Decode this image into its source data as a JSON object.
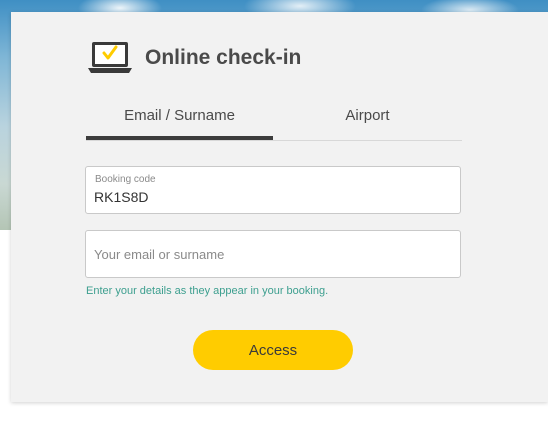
{
  "header": {
    "title": "Online check-in",
    "icon": "laptop-check-icon",
    "accent_color": "#ffcc00"
  },
  "tabs": [
    {
      "label": "Email / Surname",
      "active": true
    },
    {
      "label": "Airport",
      "active": false
    }
  ],
  "form": {
    "booking_code": {
      "label": "Booking code",
      "value": "RK1S8D"
    },
    "email_surname": {
      "placeholder": "Your email or surname",
      "value": ""
    },
    "hint": "Enter your details as they appear in your booking.",
    "submit_label": "Access"
  }
}
